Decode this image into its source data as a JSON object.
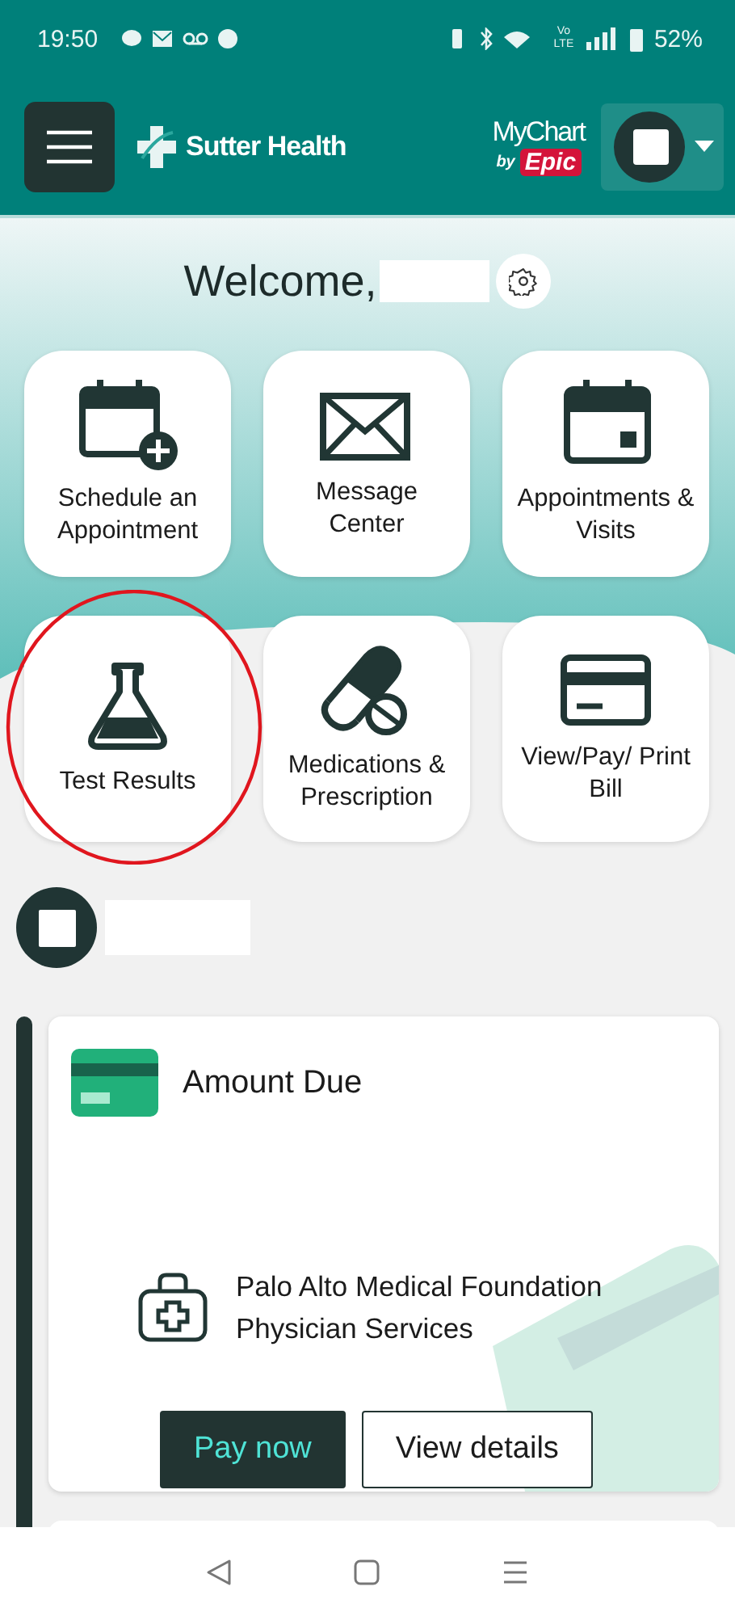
{
  "status_bar": {
    "time": "19:50",
    "network_label": "Vo LTE",
    "battery": "52%"
  },
  "header": {
    "brand": "Sutter Health",
    "app_logo": {
      "name": "MyChart",
      "by": "by",
      "maker": "Epic"
    }
  },
  "welcome": {
    "greeting": "Welcome,"
  },
  "tiles": [
    {
      "label": "Schedule an Appointment",
      "circled": false
    },
    {
      "label": "Message Center",
      "circled": false
    },
    {
      "label": "Appointments & Visits",
      "circled": false
    },
    {
      "label": "Test Results",
      "circled": true
    },
    {
      "label": "Medications & Prescription",
      "circled": false
    },
    {
      "label": "View/Pay/ Print Bill",
      "circled": false
    }
  ],
  "feed": {
    "cards": [
      {
        "title": "Amount Due",
        "provider": "Palo Alto Medical Foundation Physician Services",
        "buttons": [
          {
            "label": "Pay now",
            "kind": "primary"
          },
          {
            "label": "View details",
            "kind": "secondary"
          }
        ]
      }
    ]
  }
}
